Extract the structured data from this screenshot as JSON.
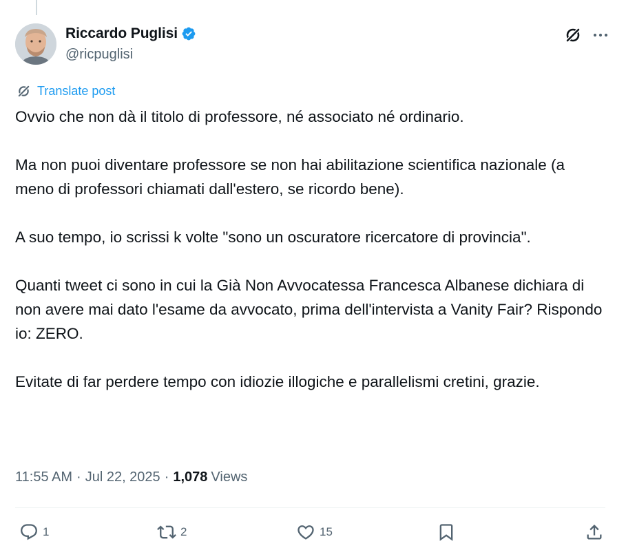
{
  "author": {
    "display_name": "Riccardo Puglisi",
    "handle": "@ricpuglisi",
    "verified": true,
    "verified_color": "#1d9bf0"
  },
  "header_icons": [
    "grok-icon",
    "more-icon"
  ],
  "translate": {
    "label": "Translate post",
    "icon": "translate-icon"
  },
  "post": {
    "paragraphs": [
      "Ovvio che non dà il titolo di professore, né associato né ordinario.",
      "Ma non puoi diventare professore se non hai abilitazione scientifica nazionale (a meno di professori chiamati dall'estero, se ricordo bene).",
      "A suo tempo, io scrissi k volte \"sono un oscuratore ricercatore di provincia\".",
      "Quanti tweet ci sono in cui la Già Non Avvocatessa Francesca Albanese dichiara di non avere mai dato l'esame da avvocato, prima dell'intervista a Vanity Fair? Rispondo io: ZERO.",
      "Evitate di far perdere tempo con idiozie illogiche e parallelismi cretini, grazie."
    ]
  },
  "meta": {
    "time": "11:55 AM",
    "separator": "·",
    "date": "Jul 22, 2025",
    "views_count": "1,078",
    "views_label": "Views"
  },
  "actions": {
    "reply": {
      "icon": "reply-icon",
      "count": "1"
    },
    "repost": {
      "icon": "repost-icon",
      "count": "2"
    },
    "like": {
      "icon": "like-icon",
      "count": "15"
    },
    "bookmark": {
      "icon": "bookmark-icon"
    },
    "share": {
      "icon": "share-icon"
    }
  },
  "colors": {
    "text": "#0f1419",
    "secondary": "#536471",
    "accent": "#1d9bf0",
    "border": "#eff3f4"
  }
}
